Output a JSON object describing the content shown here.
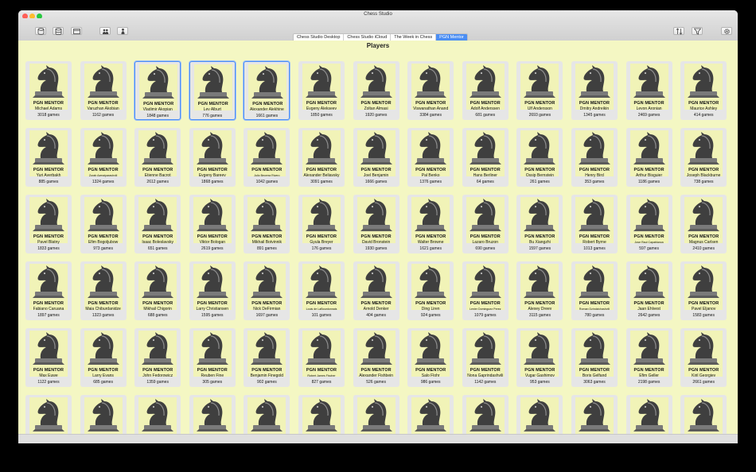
{
  "window": {
    "title": "Chess Studio"
  },
  "colors": {
    "close": "#ff5f57",
    "minimize": "#febc2e",
    "maximize": "#28c840",
    "accent": "#4b8ef3",
    "tile": "#f1f3b7"
  },
  "toolbar_left": [
    {
      "name": "databases-button",
      "icon": "database-icon"
    },
    {
      "name": "databases-stack-button",
      "icon": "database-stack-icon"
    },
    {
      "name": "browser-button",
      "icon": "browser-window-icon"
    },
    {
      "name": "players-button",
      "icon": "players-icon"
    },
    {
      "name": "tournament-button",
      "icon": "tournament-icon"
    }
  ],
  "toolbar_right": [
    {
      "name": "sort-button",
      "icon": "sort-arrows-icon"
    },
    {
      "name": "filter-button",
      "icon": "filter-icon"
    },
    {
      "name": "settings-button",
      "icon": "gear-icon"
    }
  ],
  "tabs": [
    {
      "label": "Chess Studio Desktop",
      "active": false
    },
    {
      "label": "Chess Studio iCloud",
      "active": false
    },
    {
      "label": "The Week in Chess",
      "active": false
    },
    {
      "label": "PGN Mentor",
      "active": true
    }
  ],
  "section_title": "Players",
  "cover_brand": "PGN MENTOR",
  "players": [
    {
      "name": "Michael Adams",
      "games": "3018 games"
    },
    {
      "name": "Varuzhan Akobian",
      "games": "1162 games"
    },
    {
      "name": "Vladimir Akopian",
      "games": "1848 games",
      "selected": true
    },
    {
      "name": "Lev Alburt",
      "games": "776 games",
      "selected": true
    },
    {
      "name": "Alexander Alekhine",
      "games": "1661 games",
      "selected": true
    },
    {
      "name": "Evgeny Alekseev",
      "games": "1850 games"
    },
    {
      "name": "Zoltan Almasi",
      "games": "1920 games"
    },
    {
      "name": "Viswanathan Anand",
      "games": "3384 games"
    },
    {
      "name": "Adolf Anderssen",
      "games": "681 games"
    },
    {
      "name": "Ulf Andersson",
      "games": "2693 games"
    },
    {
      "name": "Dmitry Andreikin",
      "games": "1345 games"
    },
    {
      "name": "Levon Aronian",
      "games": "2469 games"
    },
    {
      "name": "Maurice Ashley",
      "games": "414 games"
    },
    {
      "name": "Yuri Averbakh",
      "games": "885 games"
    },
    {
      "name": "Zurab Azmaiparashvili",
      "games": "1324 games",
      "small": true
    },
    {
      "name": "Etienne Bacrot",
      "games": "2612 games"
    },
    {
      "name": "Evgeny Bareev",
      "games": "1868 games"
    },
    {
      "name": "Julio Becerra Rivero",
      "games": "1042 games",
      "small": true
    },
    {
      "name": "Alexander Beliavsky",
      "games": "3091 games"
    },
    {
      "name": "Joel Benjamin",
      "games": "1666 games"
    },
    {
      "name": "Pal Benko",
      "games": "1376 games"
    },
    {
      "name": "Hans Berliner",
      "games": "64 games"
    },
    {
      "name": "Ossip Bernstein",
      "games": "261 games"
    },
    {
      "name": "Henry Bird",
      "games": "353 games"
    },
    {
      "name": "Arthur Bisguier",
      "games": "1186 games"
    },
    {
      "name": "Joseph Blackburne",
      "games": "738 games"
    },
    {
      "name": "Pavel Blatny",
      "games": "1833 games"
    },
    {
      "name": "Efim Bogoljubow",
      "games": "973 games"
    },
    {
      "name": "Isaac Boleslavsky",
      "games": "651 games"
    },
    {
      "name": "Viktor Bologan",
      "games": "2619 games"
    },
    {
      "name": "Mikhail Botvinnik",
      "games": "891 games"
    },
    {
      "name": "Gyula Breyer",
      "games": "176 games"
    },
    {
      "name": "David Bronstein",
      "games": "1930 games"
    },
    {
      "name": "Walter Browne",
      "games": "1621 games"
    },
    {
      "name": "Lazaro Bruzon",
      "games": "690 games"
    },
    {
      "name": "Bu Xiangzhi",
      "games": "1597 games"
    },
    {
      "name": "Robert Byrne",
      "games": "1013 games"
    },
    {
      "name": "Jose Raul Capablanca",
      "games": "597 games",
      "small": true
    },
    {
      "name": "Magnus Carlsen",
      "games": "2410 games"
    },
    {
      "name": "Fabiano Caruana",
      "games": "1897 games"
    },
    {
      "name": "Maia Chiburdanidze",
      "games": "1323 games"
    },
    {
      "name": "Mikhail Chigorin",
      "games": "688 games"
    },
    {
      "name": "Larry Christiansen",
      "games": "1595 games"
    },
    {
      "name": "Nick DeFirmian",
      "games": "1697 games"
    },
    {
      "name": "Louis de LaBourdonnais",
      "games": "101 games",
      "small": true
    },
    {
      "name": "Arnold Denker",
      "games": "404 games"
    },
    {
      "name": "Ding Liren",
      "games": "924 games"
    },
    {
      "name": "Lenier Dominguez Perez",
      "games": "1079 games",
      "small": true
    },
    {
      "name": "Alexey Dreev",
      "games": "3115 games"
    },
    {
      "name": "Roman Dzindzichashvili",
      "games": "780 games",
      "small": true
    },
    {
      "name": "Jaan Ehlvest",
      "games": "2642 games"
    },
    {
      "name": "Pavel Eljanov",
      "games": "1583 games"
    },
    {
      "name": "Max Euwe",
      "games": "1122 games"
    },
    {
      "name": "Larry Evans",
      "games": "685 games"
    },
    {
      "name": "John Fedorowicz",
      "games": "1359 games"
    },
    {
      "name": "Reuben Fine",
      "games": "305 games"
    },
    {
      "name": "Benjamin Finegold",
      "games": "902 games"
    },
    {
      "name": "Robert James Fischer",
      "games": "827 games",
      "small": true
    },
    {
      "name": "Alexander Fishbein",
      "games": "526 games"
    },
    {
      "name": "Salo Flohr",
      "games": "986 games"
    },
    {
      "name": "Nona Gaprindashvili",
      "games": "1142 games"
    },
    {
      "name": "Vugar Gashimov",
      "games": "953 games"
    },
    {
      "name": "Boris Gelfand",
      "games": "3063 games"
    },
    {
      "name": "Efim Geller",
      "games": "2198 games"
    },
    {
      "name": "Kiril Georgiev",
      "games": "2661 games"
    },
    {
      "name": "",
      "games": ""
    },
    {
      "name": "",
      "games": ""
    },
    {
      "name": "",
      "games": ""
    },
    {
      "name": "",
      "games": ""
    },
    {
      "name": "",
      "games": ""
    },
    {
      "name": "",
      "games": ""
    },
    {
      "name": "",
      "games": ""
    },
    {
      "name": "",
      "games": ""
    },
    {
      "name": "",
      "games": ""
    },
    {
      "name": "",
      "games": ""
    },
    {
      "name": "",
      "games": ""
    },
    {
      "name": "",
      "games": ""
    },
    {
      "name": "",
      "games": ""
    }
  ]
}
